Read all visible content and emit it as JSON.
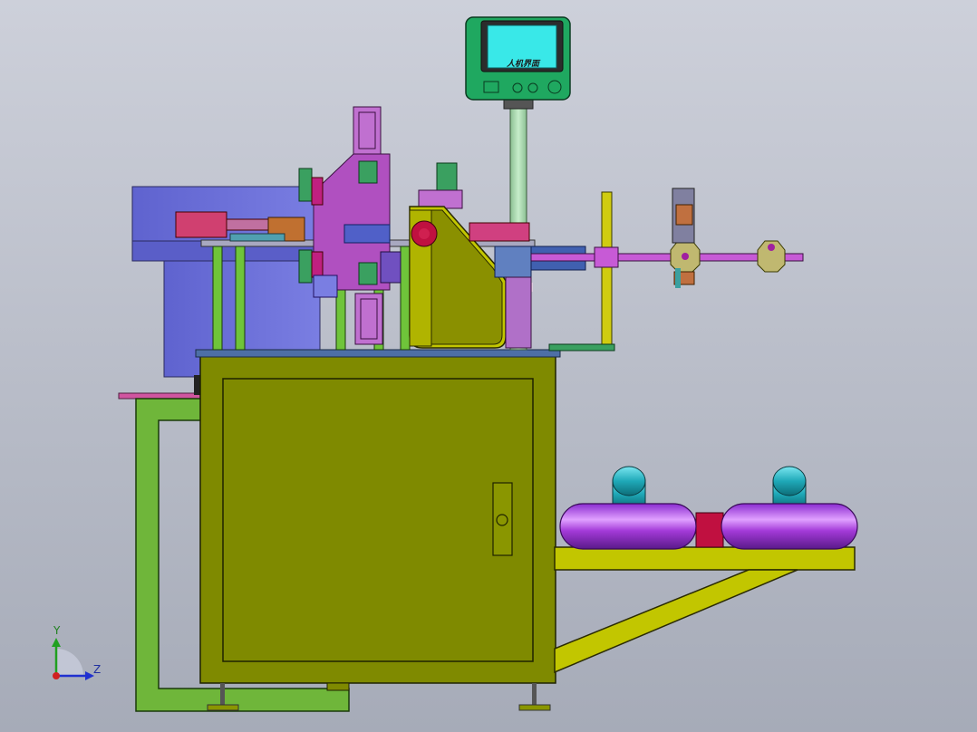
{
  "hmi": {
    "label": "人机界面"
  },
  "axes": {
    "y_label": "Y",
    "z_label": "Z"
  },
  "colors": {
    "background_top": "#c9ccd6",
    "background_bottom": "#a9aebb",
    "cabinet": "#7f8a00",
    "frame_green": "#6fb63a",
    "bowl_blue": "#6a6ed8",
    "hmi_green": "#1fa860",
    "hmi_screen": "#39e8e8",
    "spool_purple": "#a33ad8",
    "spool_cap": "#1fa9b8",
    "bracket": "#c2c600",
    "column": "#9fd0a6",
    "cylinder": "#c2337a",
    "rod": "#c75ad6"
  }
}
